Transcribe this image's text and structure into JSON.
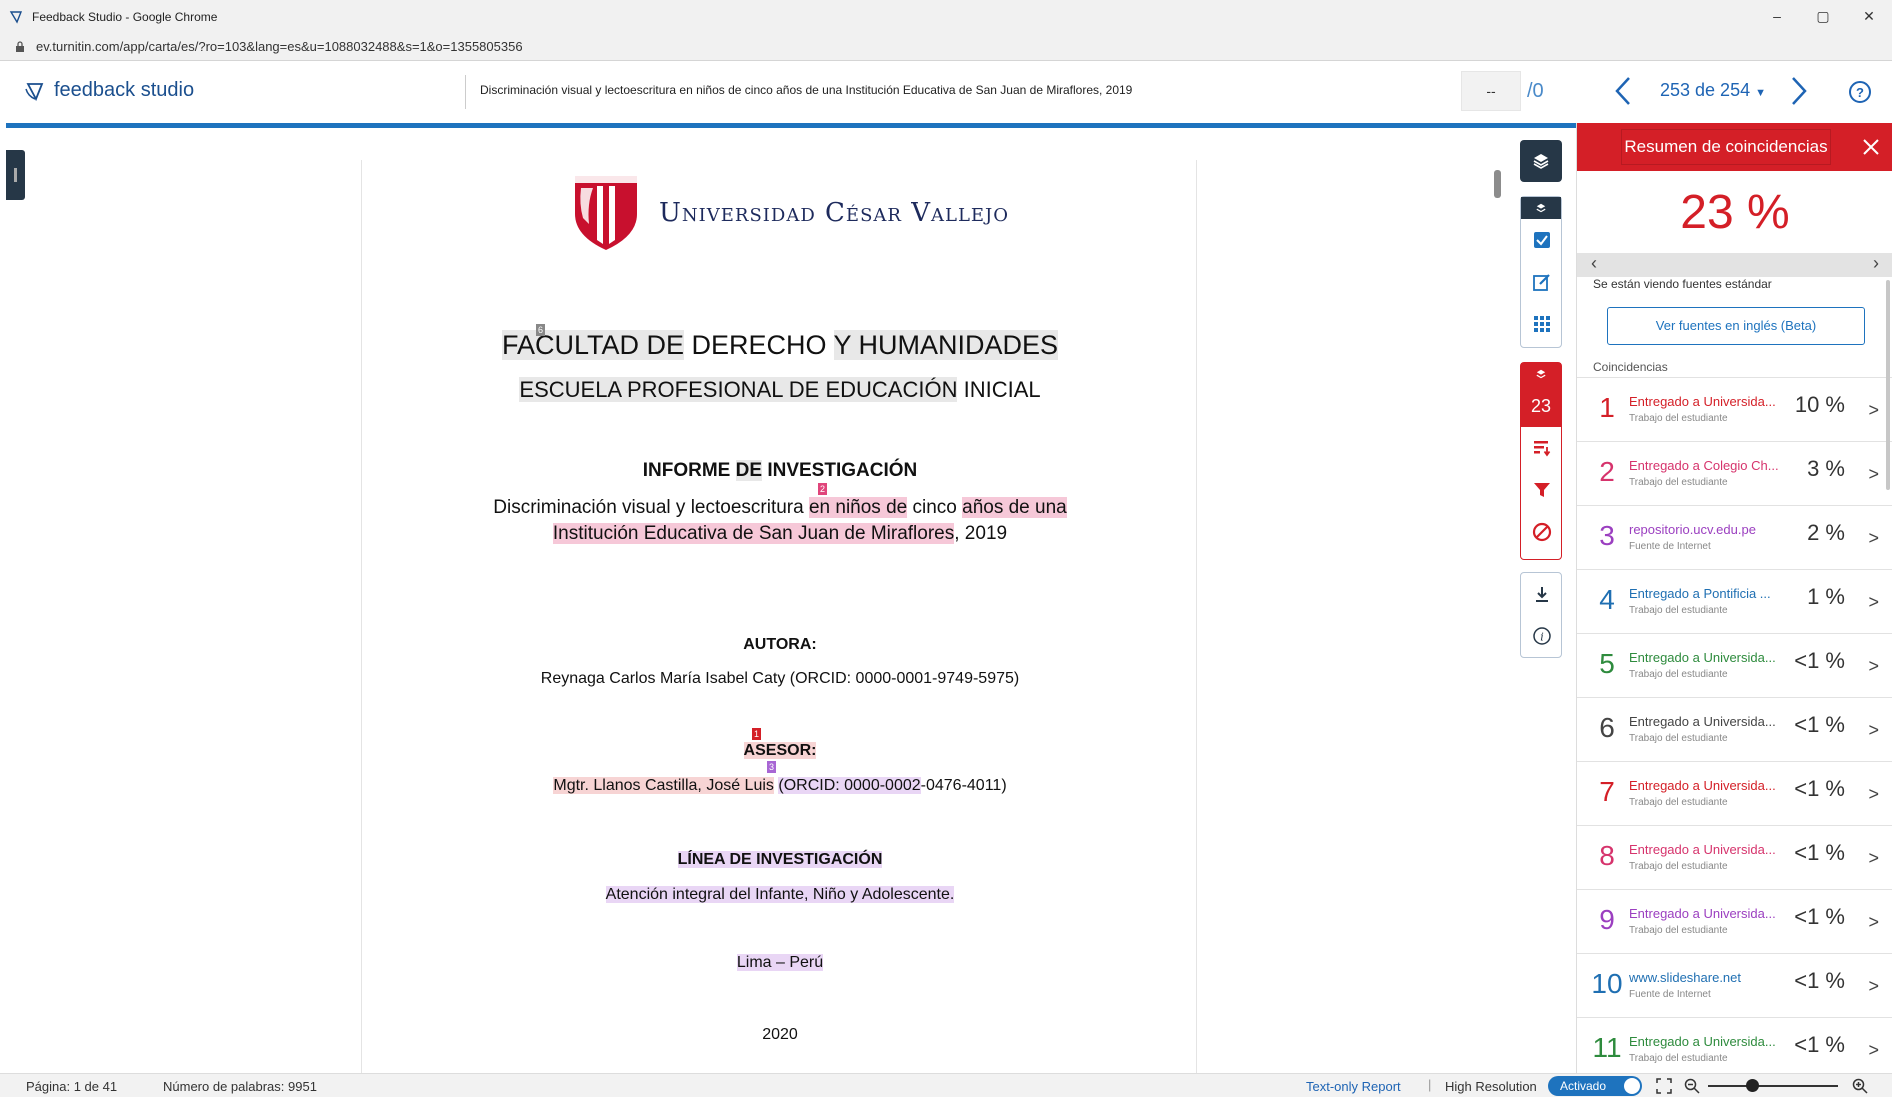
{
  "window": {
    "title": "Feedback Studio - Google Chrome",
    "url": "ev.turnitin.com/app/carta/es/?ro=103&lang=es&u=1088032488&s=1&o=1355805356",
    "controls": [
      "–",
      "▢",
      "✕"
    ]
  },
  "app": {
    "brand": "feedback studio",
    "doc_title": "Discriminación visual y lectoescritura en niños de cinco años de una Institución Educativa de San Juan de Miraflores, 2019",
    "grade_value": "--",
    "grade_of": "/0",
    "page_indicator": "253 de 254"
  },
  "document": {
    "university": "Universidad César Vallejo",
    "faculty_parts": [
      "FACULTAD DE",
      " DERECHO ",
      "Y HUMANIDADES"
    ],
    "faculty_marker": "6",
    "school_parts": [
      "ESCUELA PROFESIONAL DE EDUCACIÓN",
      " INICIAL"
    ],
    "report_parts": [
      "INFORME ",
      "DE",
      " INVESTIGACIÓN"
    ],
    "marker2": "2",
    "title_line1_parts": [
      "Discriminación visual y lectoescritura ",
      "en niños de",
      " cinco ",
      "años de una"
    ],
    "title_line2_parts": [
      "Institución Educativa de San Juan de Miraflores",
      ", 2019"
    ],
    "author_heading": "AUTORA:",
    "author": "Reynaga Carlos María Isabel Caty (ORCID: 0000-0001-9749-5975)",
    "marker1": "1",
    "advisor_heading": "ASESOR:",
    "marker3": "3",
    "advisor_parts": [
      "Mgtr. Llanos Castilla, José Luis",
      " ",
      "(ORCID: 0000-0002",
      "-0476-4011)"
    ],
    "line_heading": "LÍNEA DE INVESTIGACIÓN",
    "line_text": "Atención integral del Infante, Niño y Adolescente.",
    "place": "Lima – Perú",
    "year": "2020"
  },
  "rail": {
    "match_count": "23"
  },
  "panel": {
    "title": "Resumen de coincidencias",
    "percent": "23 %",
    "standard_note": "Se están viendo fuentes estándar",
    "english_button": "Ver fuentes en inglés (Beta)",
    "matches_label": "Coincidencias",
    "matches": [
      {
        "n": "1",
        "source": "Entregado a Universida...",
        "type": "Trabajo del estudiante",
        "pct": "10 %",
        "color": "#d41f27"
      },
      {
        "n": "2",
        "source": "Entregado a Colegio Ch...",
        "type": "Trabajo del estudiante",
        "pct": "3 %",
        "color": "#d6336c"
      },
      {
        "n": "3",
        "source": "repositorio.ucv.edu.pe",
        "type": "Fuente de Internet",
        "pct": "2 %",
        "color": "#9b3fc0"
      },
      {
        "n": "4",
        "source": "Entregado a Pontificia ...",
        "type": "Trabajo del estudiante",
        "pct": "1 %",
        "color": "#1f6fb2"
      },
      {
        "n": "5",
        "source": "Entregado a Universida...",
        "type": "Trabajo del estudiante",
        "pct": "<1 %",
        "color": "#2e8b3d"
      },
      {
        "n": "6",
        "source": "Entregado a Universida...",
        "type": "Trabajo del estudiante",
        "pct": "<1 %",
        "color": "#444444"
      },
      {
        "n": "7",
        "source": "Entregado a Universida...",
        "type": "Trabajo del estudiante",
        "pct": "<1 %",
        "color": "#d41f27"
      },
      {
        "n": "8",
        "source": "Entregado a Universida...",
        "type": "Trabajo del estudiante",
        "pct": "<1 %",
        "color": "#d6336c"
      },
      {
        "n": "9",
        "source": "Entregado a Universida...",
        "type": "Trabajo del estudiante",
        "pct": "<1 %",
        "color": "#9b3fc0"
      },
      {
        "n": "10",
        "source": "www.slideshare.net",
        "type": "Fuente de Internet",
        "pct": "<1 %",
        "color": "#1f6fb2"
      },
      {
        "n": "11",
        "source": "Entregado a Universida...",
        "type": "Trabajo del estudiante",
        "pct": "<1 %",
        "color": "#2e8b3d"
      }
    ]
  },
  "status": {
    "page": "Página: 1 de 41",
    "words": "Número de palabras: 9951",
    "text_only": "Text-only Report",
    "sep": "|",
    "high_res": "High Resolution",
    "toggle_label": "Activado"
  }
}
